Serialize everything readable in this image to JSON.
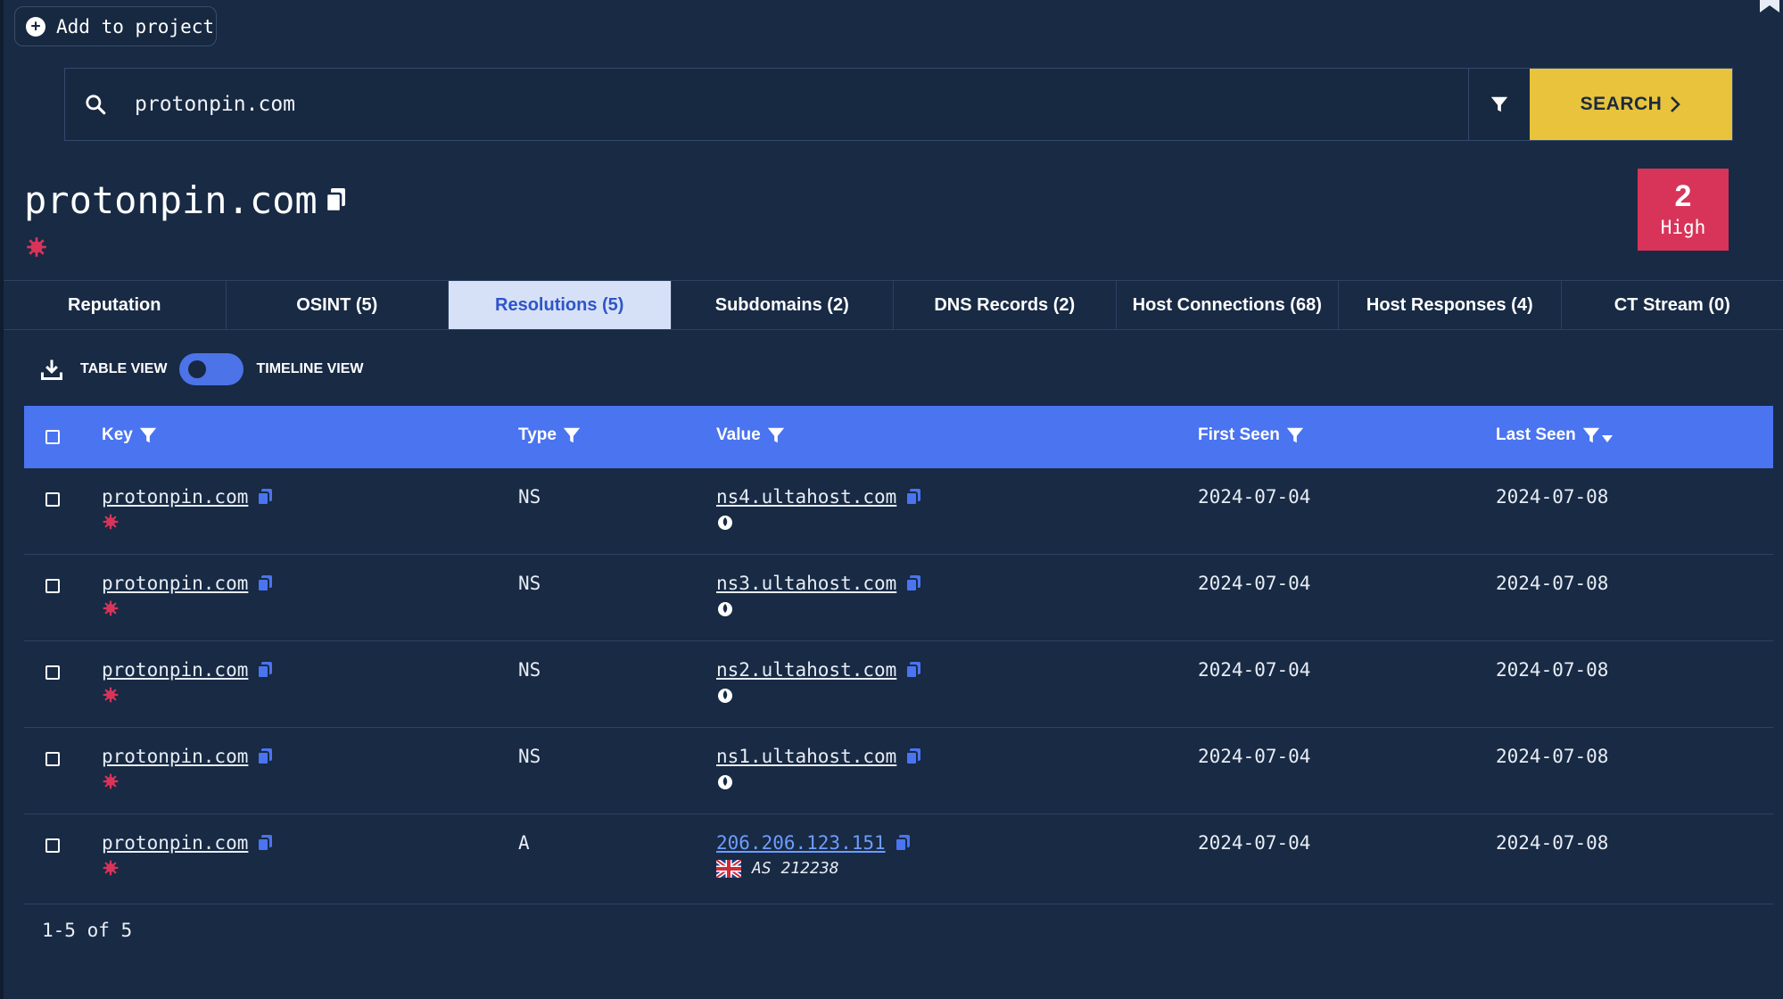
{
  "header": {
    "add_to_project_label": "Add to project"
  },
  "search": {
    "value": "protonpin.com",
    "button_label": "SEARCH"
  },
  "entity": {
    "title": "protonpin.com"
  },
  "risk": {
    "count": "2",
    "label": "High"
  },
  "tabs": [
    {
      "label": "Reputation"
    },
    {
      "label": "OSINT (5)"
    },
    {
      "label": "Resolutions (5)"
    },
    {
      "label": "Subdomains (2)"
    },
    {
      "label": "DNS Records (2)"
    },
    {
      "label": "Host Connections (68)"
    },
    {
      "label": "Host Responses (4)"
    },
    {
      "label": "CT Stream (0)"
    }
  ],
  "view": {
    "table_label": "TABLE VIEW",
    "timeline_label": "TIMELINE VIEW"
  },
  "table": {
    "columns": {
      "key": "Key",
      "type": "Type",
      "value": "Value",
      "first_seen": "First Seen",
      "last_seen": "Last Seen"
    },
    "rows": [
      {
        "key": "protonpin.com",
        "type": "NS",
        "value": "ns4.ultahost.com",
        "first_seen": "2024-07-04",
        "last_seen": "2024-07-08"
      },
      {
        "key": "protonpin.com",
        "type": "NS",
        "value": "ns3.ultahost.com",
        "first_seen": "2024-07-04",
        "last_seen": "2024-07-08"
      },
      {
        "key": "protonpin.com",
        "type": "NS",
        "value": "ns2.ultahost.com",
        "first_seen": "2024-07-04",
        "last_seen": "2024-07-08"
      },
      {
        "key": "protonpin.com",
        "type": "NS",
        "value": "ns1.ultahost.com",
        "first_seen": "2024-07-04",
        "last_seen": "2024-07-08"
      },
      {
        "key": "protonpin.com",
        "type": "A",
        "value": "206.206.123.151",
        "asn": "AS 212238",
        "first_seen": "2024-07-04",
        "last_seen": "2024-07-08"
      }
    ]
  },
  "pagination": {
    "text": "1-5 of 5"
  },
  "colors": {
    "background": "#182a44",
    "accent": "#4a74f0",
    "search_button": "#e8c33b",
    "risk_high": "#d8345a",
    "malicious_icon": "#d8345a"
  }
}
